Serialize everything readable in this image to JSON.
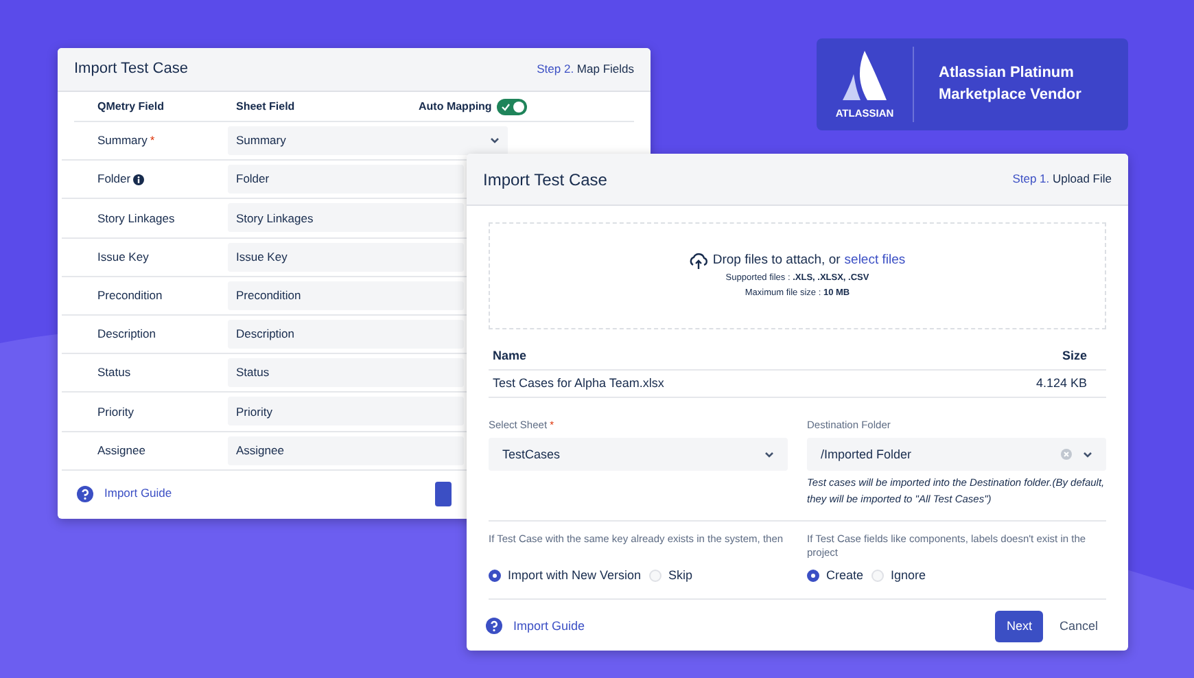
{
  "badge": {
    "logo_text": "ATLASSIAN",
    "lines": [
      "Atlassian Platinum",
      "Marketplace Vendor"
    ]
  },
  "back_window": {
    "title": "Import Test Case",
    "step": {
      "number": "Step 2.",
      "name": "Map Fields"
    },
    "columns": [
      "QMetry Field",
      "Sheet Field"
    ],
    "auto_mapping": {
      "label": "Auto Mapping",
      "on": true
    },
    "rows": [
      {
        "label": "Summary",
        "required_mark": "*",
        "info": false,
        "value": "Summary",
        "kind": "select"
      },
      {
        "label": "Folder",
        "info": true,
        "value": "Folder",
        "kind": "text"
      },
      {
        "label": "Story Linkages",
        "info": false,
        "value": "Story Linkages",
        "kind": "text"
      },
      {
        "label": "Issue Key",
        "info": false,
        "value": "Issue Key",
        "kind": "text"
      },
      {
        "label": "Precondition",
        "info": false,
        "value": "Precondition",
        "kind": "text"
      },
      {
        "label": "Description",
        "info": false,
        "value": "Description",
        "kind": "text"
      },
      {
        "label": "Status",
        "info": false,
        "value": "Status",
        "kind": "text"
      },
      {
        "label": "Priority",
        "info": false,
        "value": "Priority",
        "kind": "text"
      },
      {
        "label": "Assignee",
        "info": false,
        "value": "Assignee",
        "kind": "text"
      }
    ],
    "guide_link": "Import Guide"
  },
  "front_window": {
    "title": "Import Test Case",
    "step": {
      "number": "Step 1.",
      "name": "Upload File"
    },
    "dropzone": {
      "text": "Drop files to attach, or",
      "link": "select files",
      "supported": "Supported files : **.XLS, .XLSX, .CSV**",
      "max_size": "Maximum file size : **10 MB**"
    },
    "table": {
      "columns": [
        "Name",
        "Size"
      ],
      "rows": [
        [
          "Test Cases for Alpha Team.xlsx",
          "4.124 KB"
        ]
      ]
    },
    "sheet": {
      "label": "Select Sheet",
      "required_mark": "*",
      "value": "TestCases"
    },
    "destination": {
      "label": "Destination Folder",
      "value": "/Imported Folder",
      "help": "Test cases will be imported into the Destination folder.(By default, they will be imported to \"All Test Cases\")"
    },
    "option_groups": [
      {
        "question": "If Test Case with the same key already exists in the system, then",
        "options": [
          {
            "label": "Import with New Version",
            "selected": true
          },
          {
            "label": "Skip",
            "selected": false
          }
        ]
      },
      {
        "question": "If Test Case fields like components, labels doesn't exist in the project",
        "options": [
          {
            "label": "Create",
            "selected": true
          },
          {
            "label": "Ignore",
            "selected": false
          }
        ]
      }
    ],
    "guide_link": "Import Guide",
    "buttons": [
      {
        "label": "Next",
        "kind": "primary"
      },
      {
        "label": "Cancel",
        "kind": "link"
      }
    ]
  }
}
